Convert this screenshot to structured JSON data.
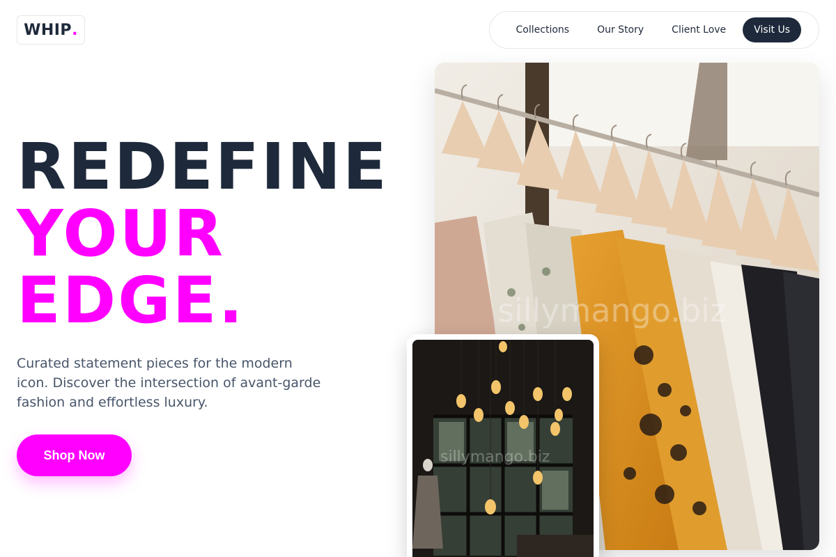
{
  "brand": {
    "name": "WHIP",
    "dot": ".",
    "accent": "#ff00ff",
    "dark": "#1e293b"
  },
  "nav": {
    "items": [
      {
        "label": "Collections"
      },
      {
        "label": "Our Story"
      },
      {
        "label": "Client Love"
      },
      {
        "label": "Visit Us"
      }
    ]
  },
  "hero": {
    "line1": "REDEFINE",
    "line2": "YOUR",
    "line3": "EDGE.",
    "subtitle": "Curated statement pieces for the modern icon. Discover the intersection of avant-garde fashion and effortless luxury.",
    "cta": "Shop Now"
  },
  "images": {
    "main": {
      "watermark": "sillymango.biz"
    },
    "inset": {
      "watermark": "sillymango.biz"
    }
  }
}
